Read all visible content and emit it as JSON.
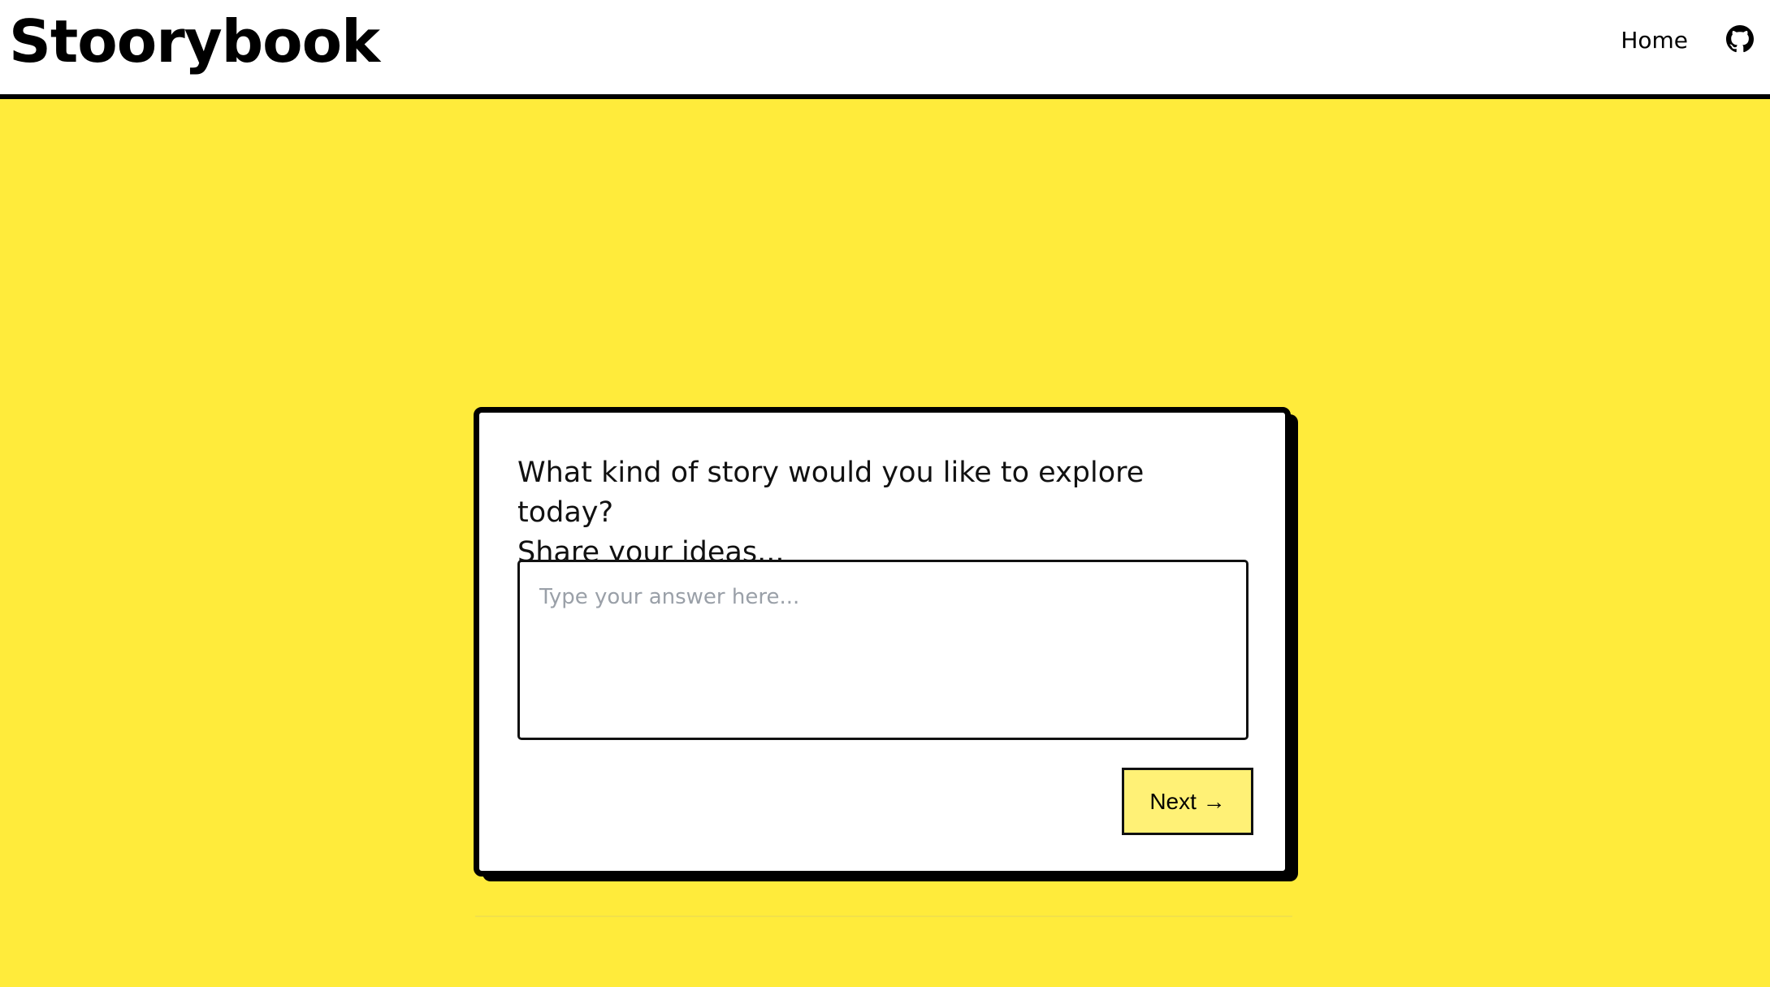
{
  "header": {
    "logo": "Stoorybook",
    "nav_home": "Home",
    "github_icon": "github-icon"
  },
  "prompt": {
    "question_line1": "What kind of story would you like to explore today?",
    "question_line2": "Share your ideas...",
    "answer_value": "",
    "answer_placeholder": "Type your answer here...",
    "next_label": "Next →"
  },
  "colors": {
    "background": "#ffeb3b",
    "button": "#fff176",
    "border": "#000000"
  }
}
